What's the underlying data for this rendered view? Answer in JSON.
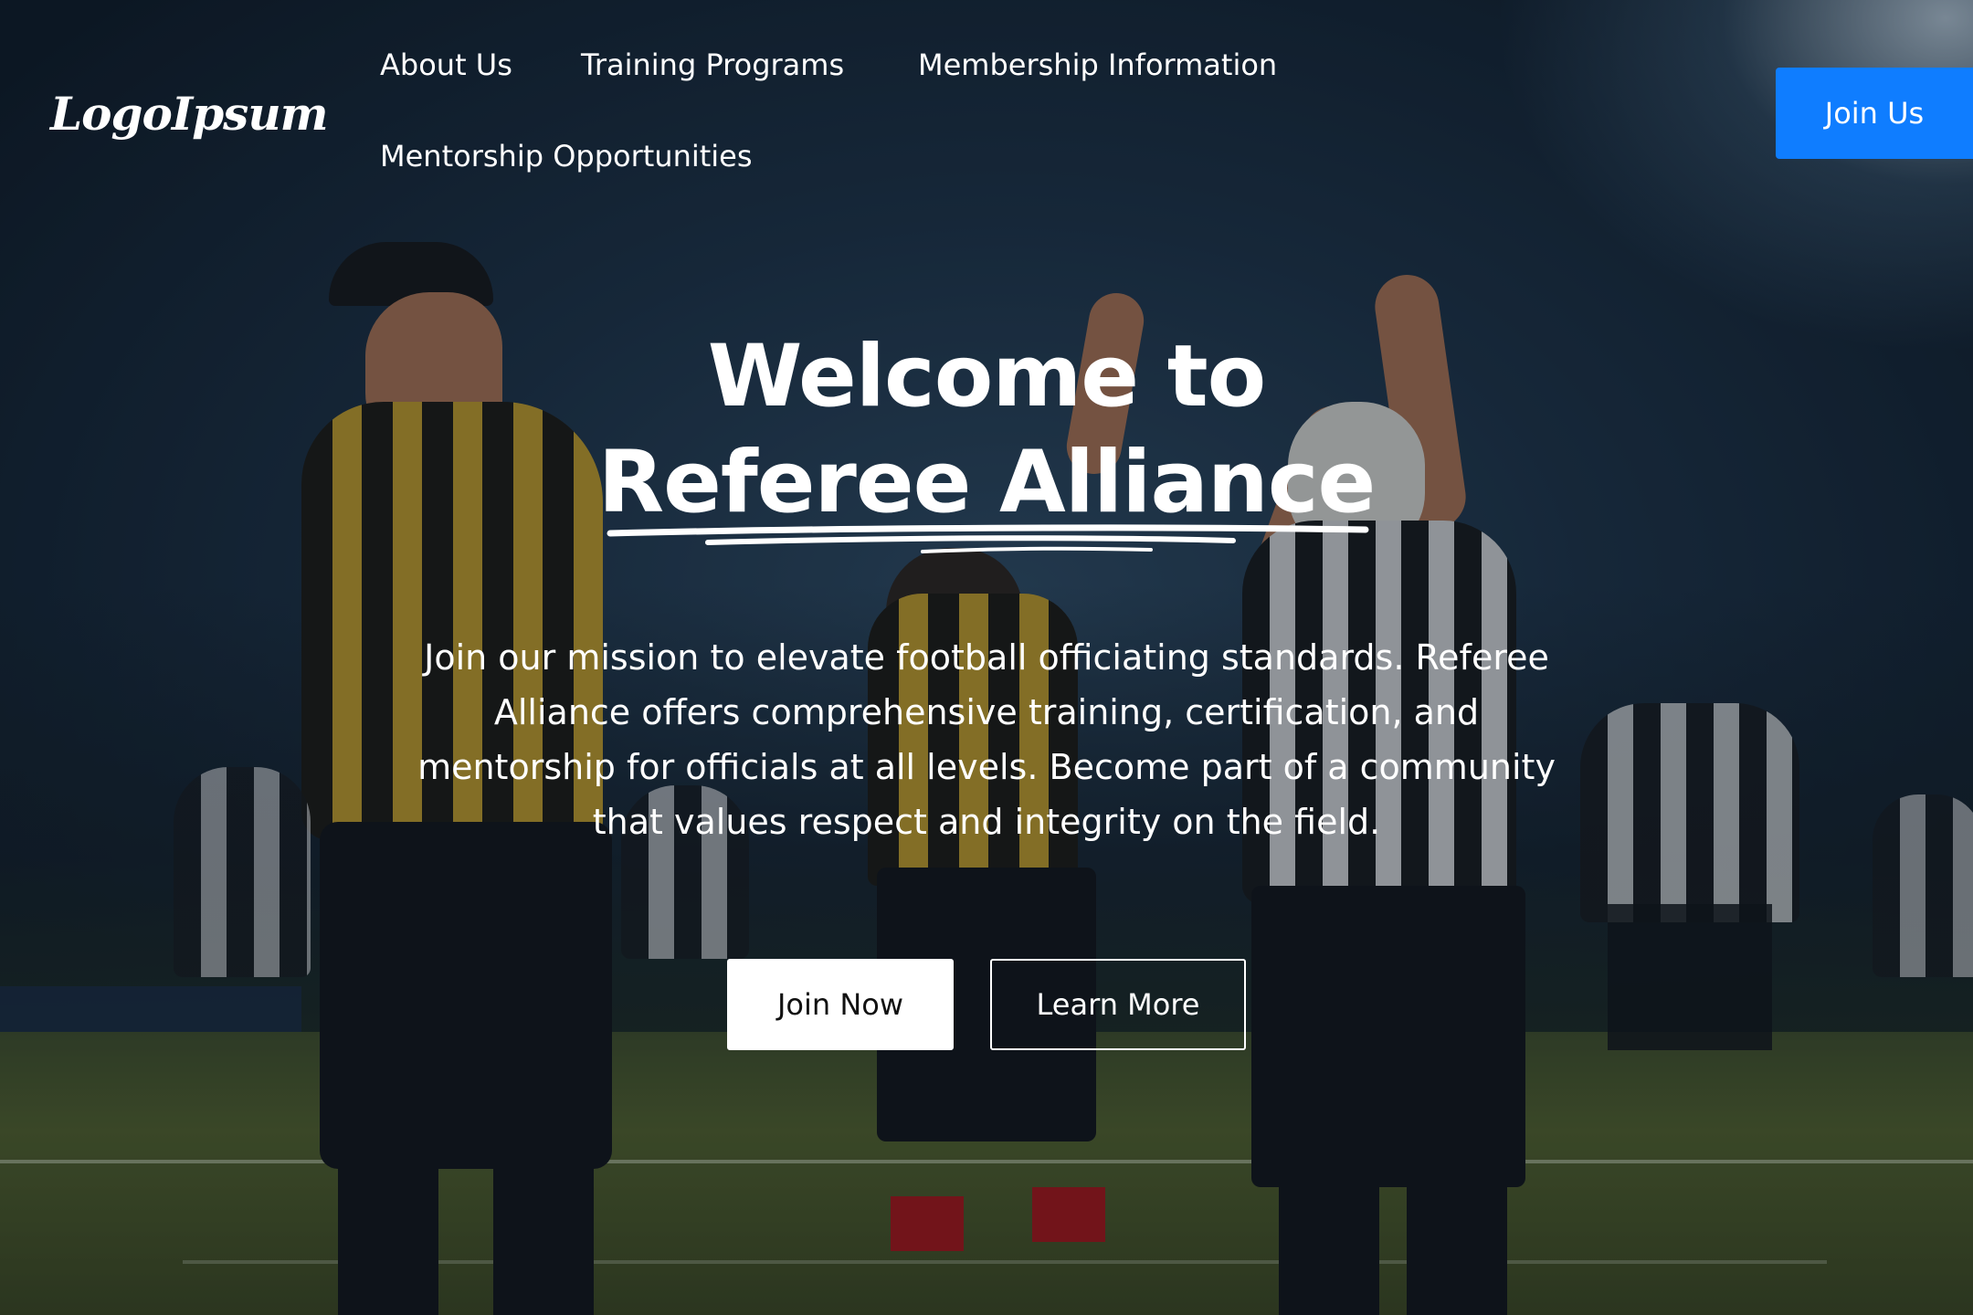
{
  "header": {
    "logo_text": "LogoIpsum",
    "nav": [
      {
        "label": "About Us"
      },
      {
        "label": "Training Programs"
      },
      {
        "label": "Membership Information"
      },
      {
        "label": "Mentorship Opportunities"
      }
    ],
    "cta_label": "Join Us"
  },
  "hero": {
    "title_line1": "Welcome to",
    "title_line2": "Referee Alliance",
    "description": "Join our mission to elevate football officiating standards. Referee Alliance offers comprehensive training, certification, and mentorship for officials at all levels. Become part of a community that values respect and integrity on the field.",
    "primary_button": "Join Now",
    "secondary_button": "Learn More",
    "background_image": "football-referees-night-match"
  },
  "colors": {
    "accent": "#0f7dff",
    "text": "#ffffff",
    "button_primary_bg": "#ffffff"
  }
}
